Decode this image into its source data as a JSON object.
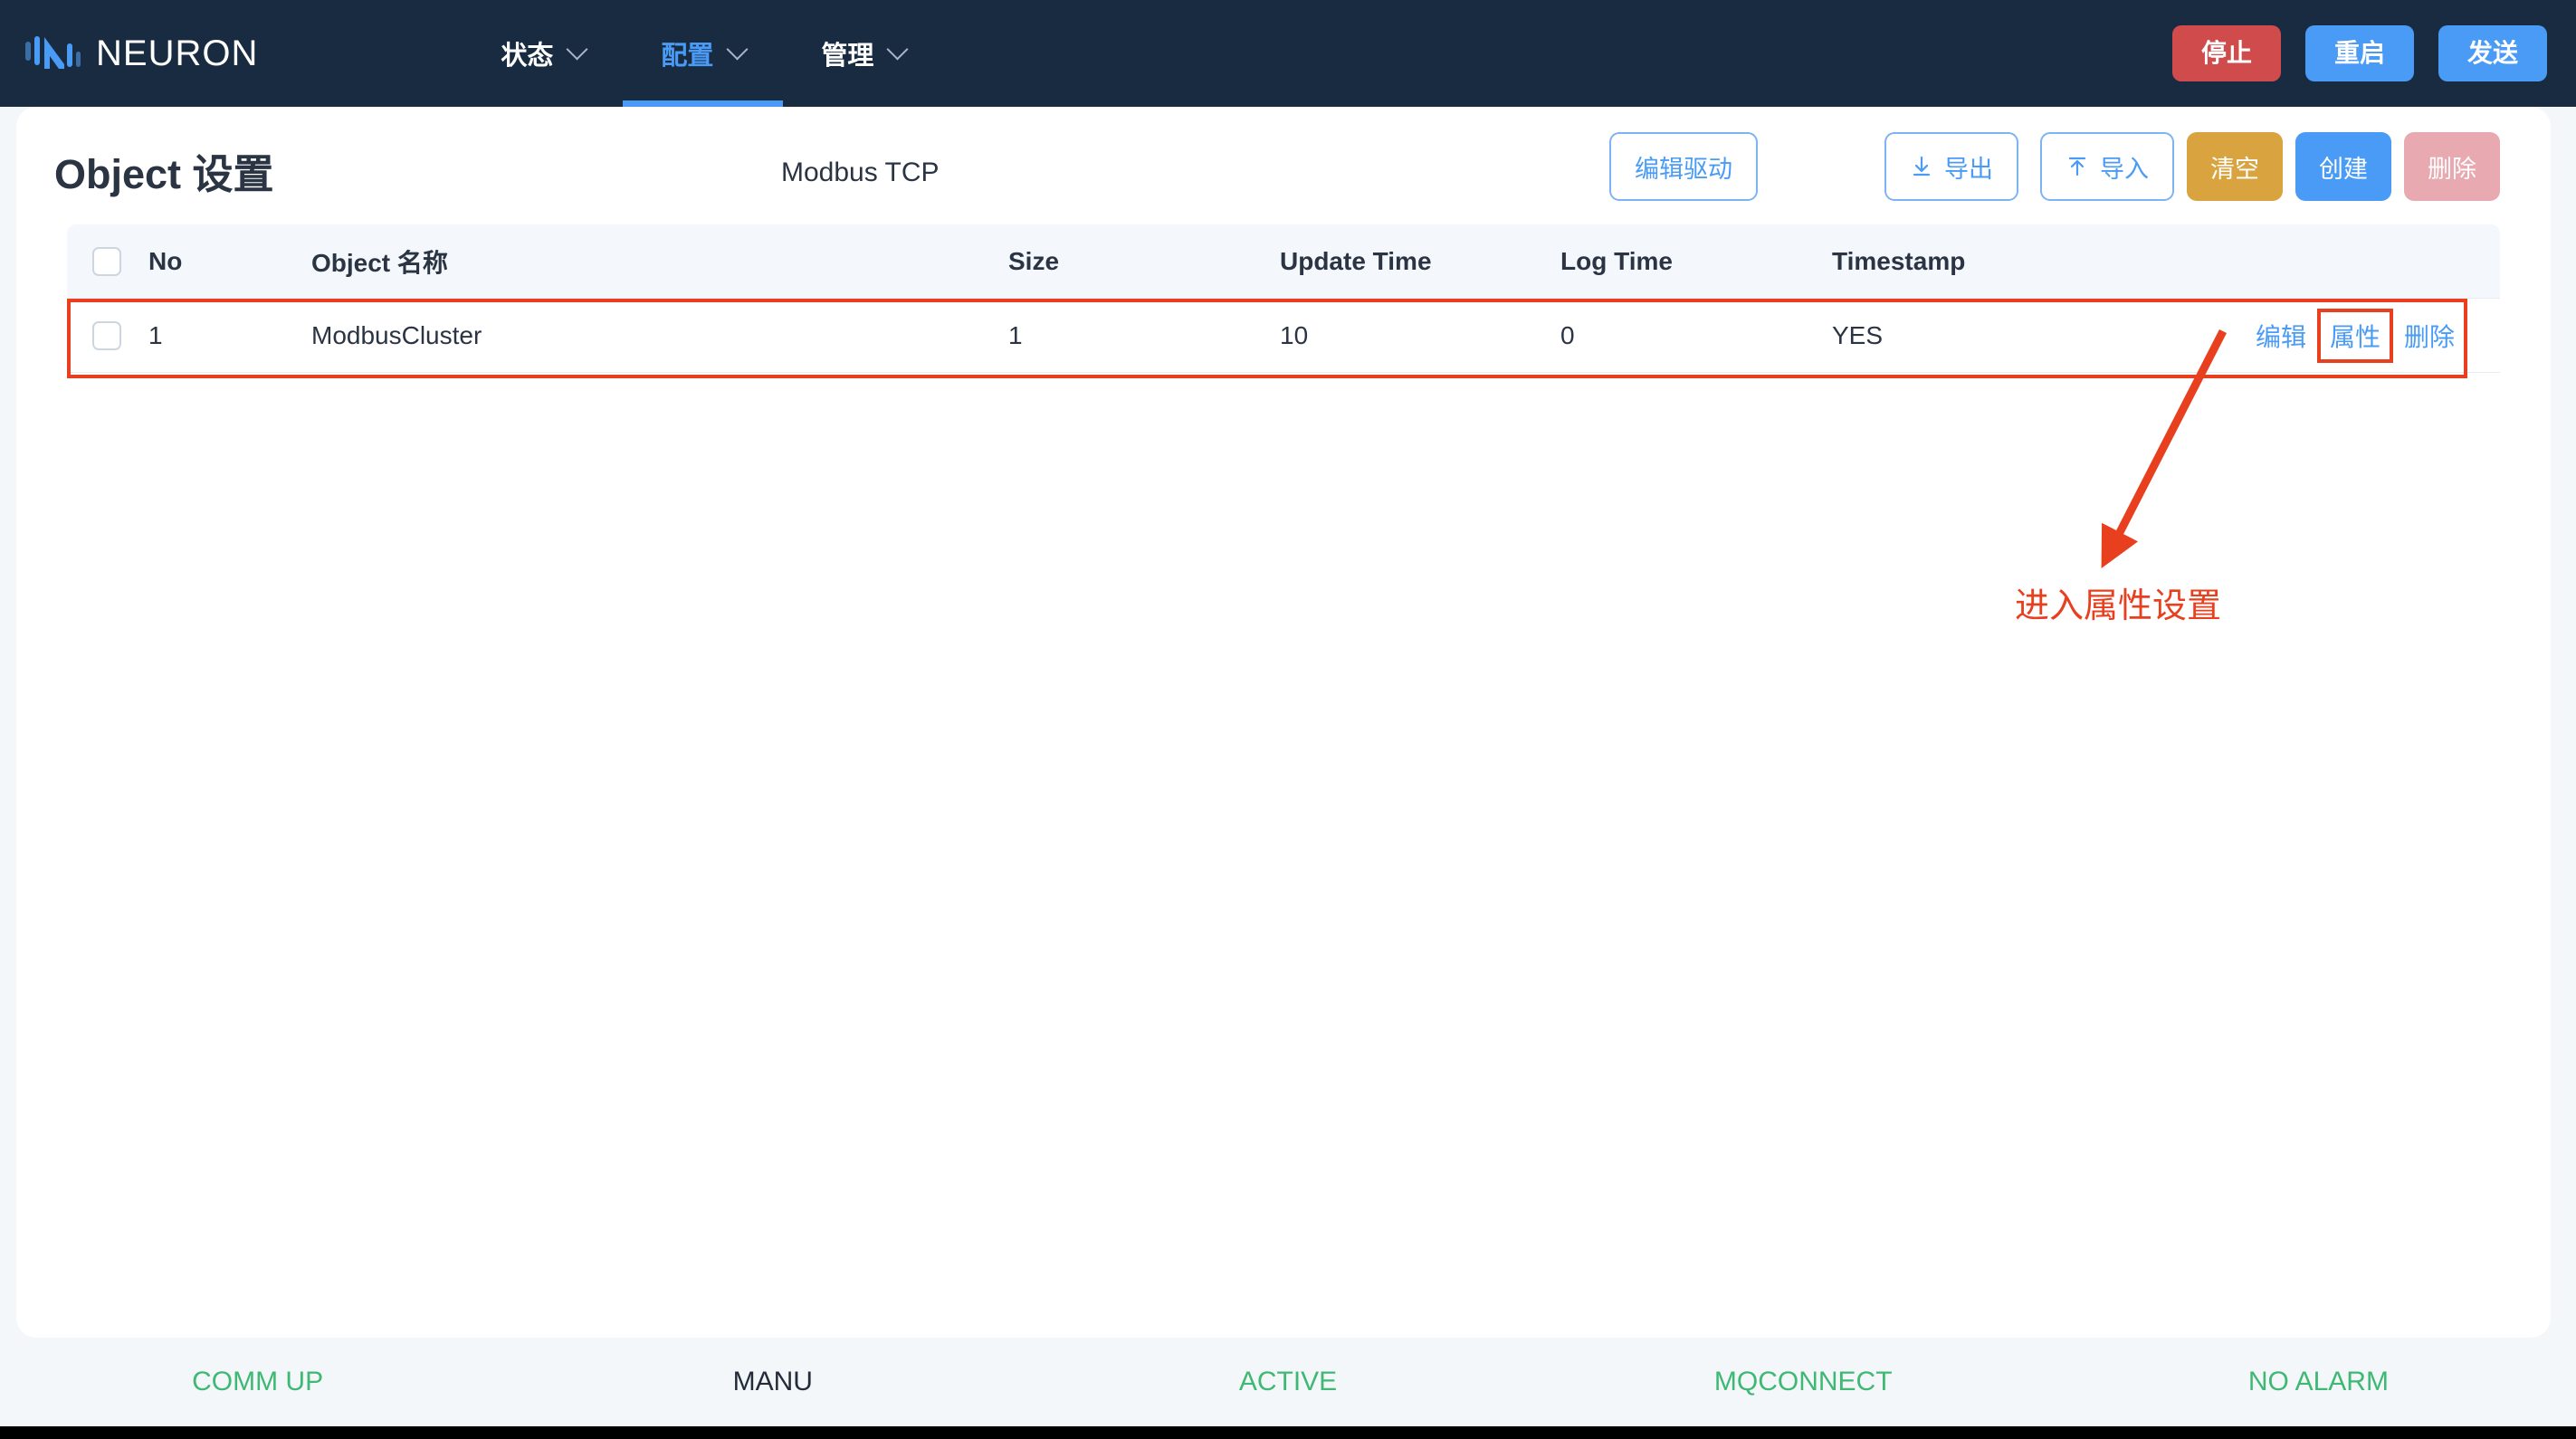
{
  "navbar": {
    "brand": "NEURON",
    "logo_icon": "neuron-logo-icon",
    "menu": [
      {
        "label": "状态",
        "active": false,
        "icon": "chevron-down-icon"
      },
      {
        "label": "配置",
        "active": true,
        "icon": "chevron-down-icon"
      },
      {
        "label": "管理",
        "active": false,
        "icon": "chevron-down-icon"
      }
    ],
    "actions": {
      "stop": "停止",
      "restart": "重启",
      "send": "发送"
    },
    "colors": {
      "background": "#182b41",
      "accent": "#4a9bf5",
      "stop": "#d04b4b"
    }
  },
  "header": {
    "title": "Object 设置",
    "plugin_name": "Modbus TCP",
    "buttons": {
      "edit_driver": "编辑驱动",
      "export": "导出",
      "export_icon": "download-icon",
      "import": "导入",
      "import_icon": "upload-icon",
      "clear": "清空",
      "create": "创建",
      "delete": "删除"
    },
    "colors": {
      "clear": "#d9a440",
      "create": "#4a9bf5",
      "delete": "#e8a9b0",
      "outline": "#4a9bf5"
    }
  },
  "table": {
    "columns": {
      "select": "",
      "no": "No",
      "name": "Object 名称",
      "size": "Size",
      "update_time": "Update Time",
      "log_time": "Log Time",
      "timestamp": "Timestamp",
      "actions": ""
    },
    "rows": [
      {
        "no": "1",
        "name": "ModbusCluster",
        "size": "1",
        "update_time": "10",
        "log_time": "0",
        "timestamp": "YES",
        "actions": {
          "edit": "编辑",
          "attributes": "属性",
          "delete": "删除"
        }
      }
    ]
  },
  "annotation": {
    "text": "进入属性设置",
    "color": "#e8401f",
    "highlight_target": "属性"
  },
  "statusbar": {
    "items": [
      {
        "label": "COMM UP",
        "color": "#3fb873"
      },
      {
        "label": "MANU",
        "color": "#232c38"
      },
      {
        "label": "ACTIVE",
        "color": "#3fb873"
      },
      {
        "label": "MQCONNECT",
        "color": "#3fb873"
      },
      {
        "label": "NO ALARM",
        "color": "#3fb873"
      }
    ]
  }
}
